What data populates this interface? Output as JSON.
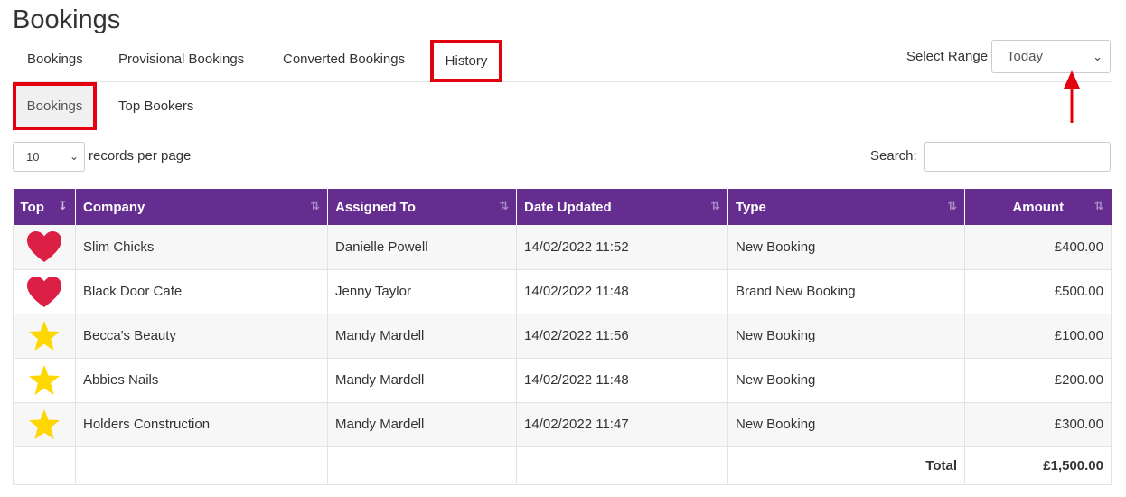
{
  "page": {
    "title": "Bookings"
  },
  "tabs": [
    "Bookings",
    "Provisional Bookings",
    "Converted Bookings",
    "History"
  ],
  "subtabs": [
    "Bookings",
    "Top Bookers"
  ],
  "range": {
    "label": "Select Range",
    "value": "Today"
  },
  "per_page": {
    "value": "10",
    "label": "records per page"
  },
  "search": {
    "label": "Search:",
    "value": ""
  },
  "table": {
    "headers": [
      "Top",
      "Company",
      "Assigned To",
      "Date Updated",
      "Type",
      "Amount"
    ],
    "rows": [
      {
        "icon": "heart-icon",
        "company": "Slim Chicks",
        "assigned": "Danielle Powell",
        "date": "14/02/2022 11:52",
        "type": "New Booking",
        "amount": "£400.00"
      },
      {
        "icon": "heart-icon",
        "company": "Black Door Cafe",
        "assigned": "Jenny Taylor",
        "date": "14/02/2022 11:48",
        "type": "Brand New Booking",
        "amount": "£500.00"
      },
      {
        "icon": "star-icon",
        "company": "Becca's Beauty",
        "assigned": "Mandy Mardell",
        "date": "14/02/2022 11:56",
        "type": "New Booking",
        "amount": "£100.00"
      },
      {
        "icon": "star-icon",
        "company": "Abbies Nails",
        "assigned": "Mandy Mardell",
        "date": "14/02/2022 11:48",
        "type": "New Booking",
        "amount": "£200.00"
      },
      {
        "icon": "star-icon",
        "company": "Holders Construction",
        "assigned": "Mandy Mardell",
        "date": "14/02/2022 11:47",
        "type": "New Booking",
        "amount": "£300.00"
      }
    ],
    "total_label": "Total",
    "total_value": "£1,500.00"
  },
  "colors": {
    "header": "#662d91",
    "highlight": "#e5000f",
    "heart": "#dc1f44",
    "star": "#ffd700"
  }
}
